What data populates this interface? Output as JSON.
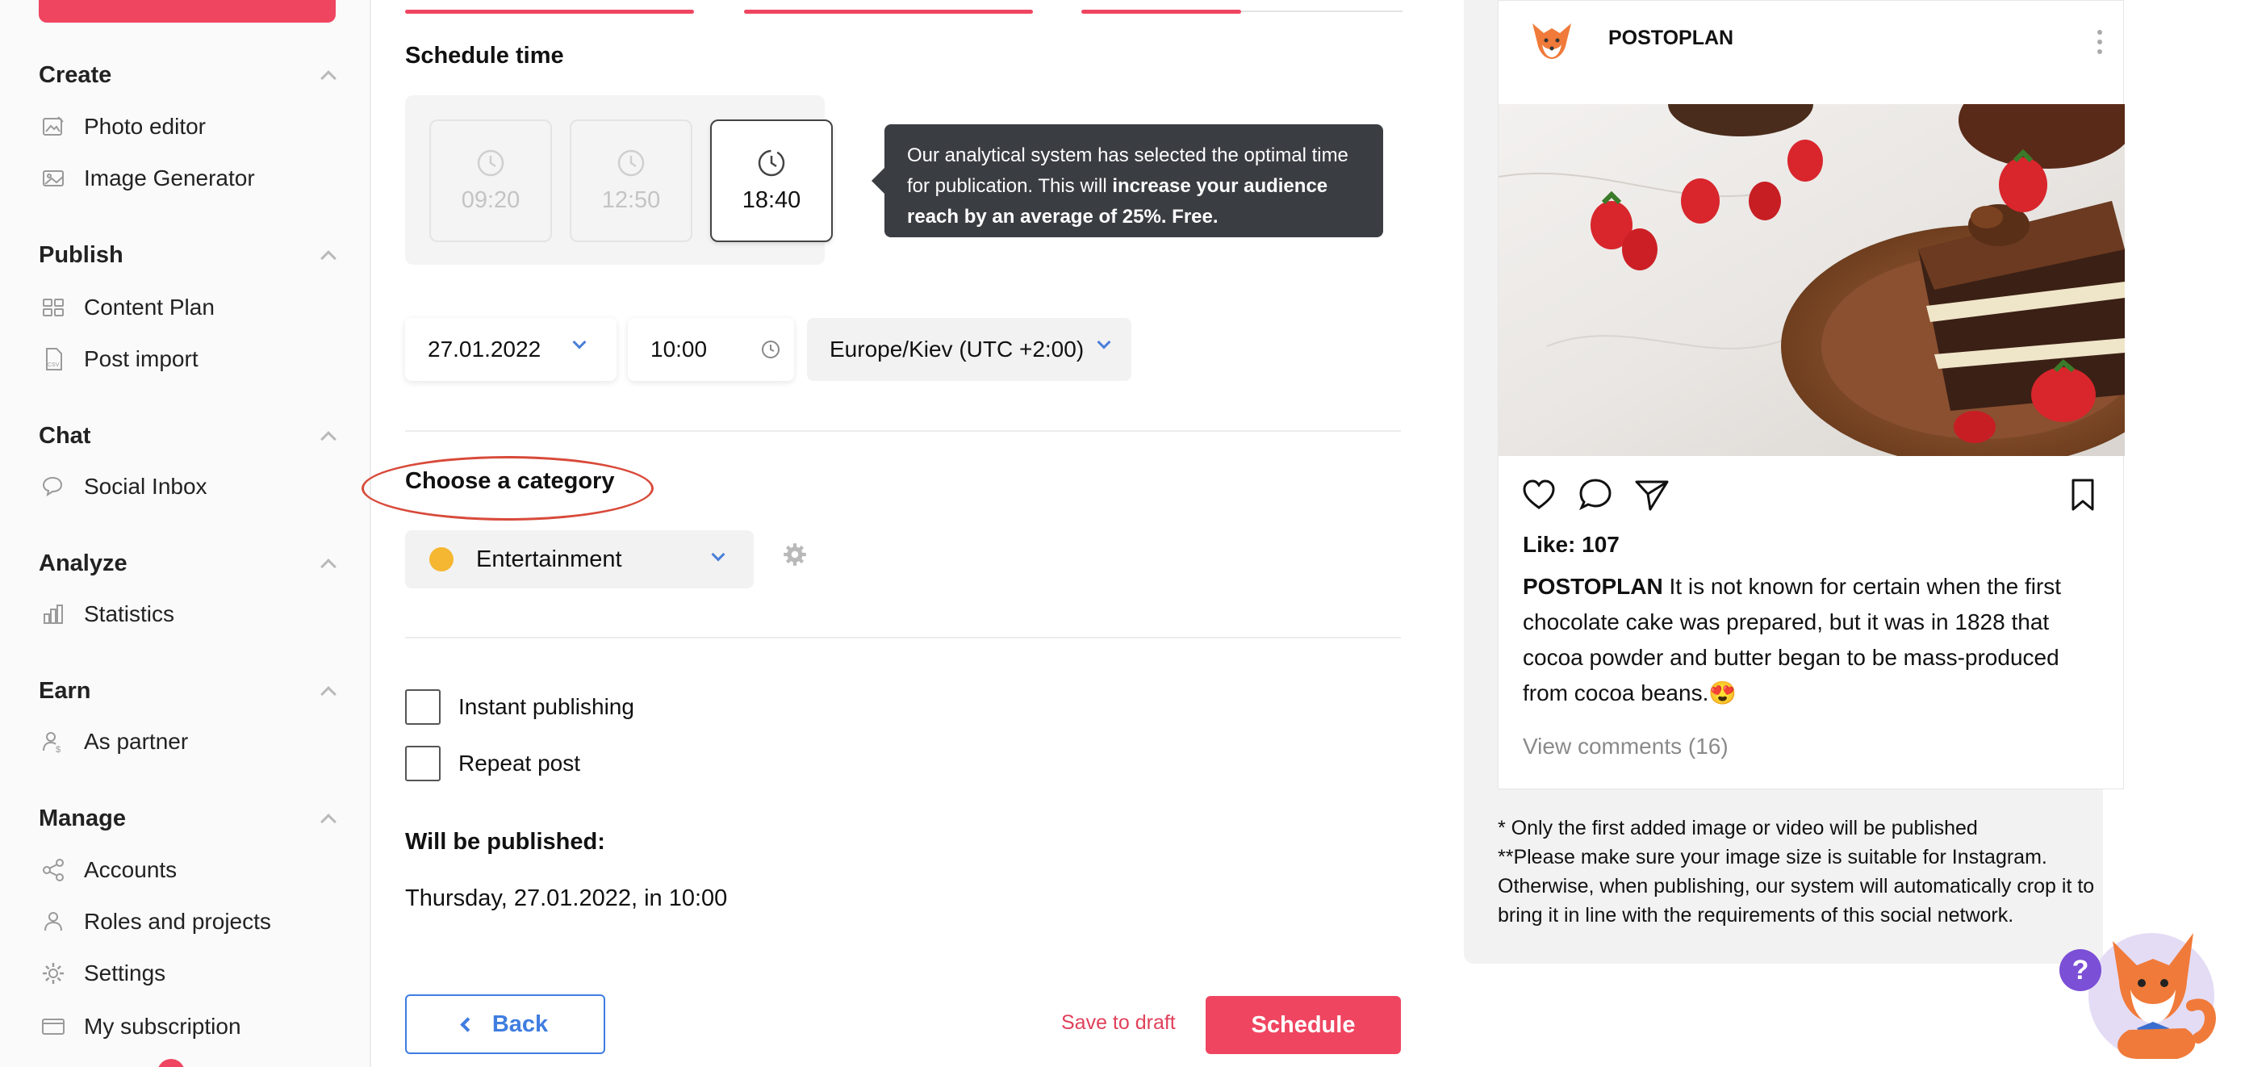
{
  "sidebar": {
    "sections": [
      {
        "title": "Create",
        "items": [
          {
            "label": "Photo editor",
            "icon": "image-edit-icon"
          },
          {
            "label": "Image Generator",
            "icon": "image-icon"
          }
        ]
      },
      {
        "title": "Publish",
        "items": [
          {
            "label": "Content Plan",
            "icon": "grid-icon"
          },
          {
            "label": "Post import",
            "icon": "csv-file-icon"
          }
        ]
      },
      {
        "title": "Chat",
        "items": [
          {
            "label": "Social Inbox",
            "icon": "chat-bubbles-icon"
          }
        ]
      },
      {
        "title": "Analyze",
        "items": [
          {
            "label": "Statistics",
            "icon": "bar-chart-icon"
          }
        ]
      },
      {
        "title": "Earn",
        "items": [
          {
            "label": "As partner",
            "icon": "partner-dollar-icon"
          }
        ]
      },
      {
        "title": "Manage",
        "items": [
          {
            "label": "Accounts",
            "icon": "share-nodes-icon"
          },
          {
            "label": "Roles and projects",
            "icon": "users-icon"
          },
          {
            "label": "Settings",
            "icon": "gear-icon"
          },
          {
            "label": "My subscription",
            "icon": "card-icon"
          }
        ]
      }
    ]
  },
  "form": {
    "schedule_title": "Schedule time",
    "time_slots": [
      {
        "time": "09:20",
        "active": false
      },
      {
        "time": "12:50",
        "active": false
      },
      {
        "time": "18:40",
        "active": true
      }
    ],
    "tooltip": {
      "text_normal": "Our analytical system has selected the optimal time for publication. This will ",
      "text_bold": "increase your audience reach by an average of 25%. Free."
    },
    "date": "27.01.2022",
    "time": "10:00",
    "timezone": "Europe/Kiev (UTC +2:00)",
    "category_title": "Choose a category",
    "category": {
      "label": "Entertainment",
      "color": "#f5b731"
    },
    "checkboxes": {
      "instant": "Instant publishing",
      "repeat": "Repeat post"
    },
    "will_be_published_title": "Will be published:",
    "will_be_published_value": "Thursday, 27.01.2022, in 10:00",
    "back_label": "Back",
    "save_draft_label": "Save to draft",
    "schedule_label": "Schedule"
  },
  "preview": {
    "account": "POSTOPLAN",
    "likes": "Like: 107",
    "caption_author": "POSTOPLAN",
    "caption_text": " It is not known for certain when the first chocolate cake was prepared, but it was in 1828 that cocoa powder and butter began to be mass-produced from cocoa beans.😍",
    "view_comments": "View comments (16)",
    "note_1": "* Only the first added image or video will be published",
    "note_2": "**Please make sure your image size is suitable for Instagram. Otherwise, when publishing, our system will automatically crop it to bring it in line with the requirements of this social network."
  },
  "help": {
    "label": "?"
  },
  "colors": {
    "accent": "#ef4560",
    "link_blue": "#3f7de0",
    "tooltip_bg": "#3a3d42",
    "annotation": "#d84a3a"
  }
}
